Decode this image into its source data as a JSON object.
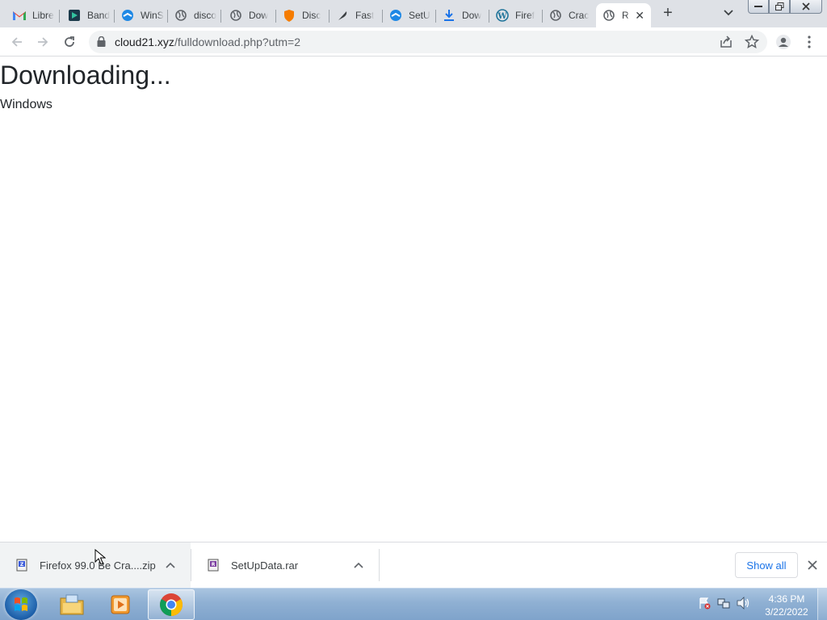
{
  "browser": {
    "tabs": [
      {
        "title": "Libre",
        "icon": "gmail-icon"
      },
      {
        "title": "Band",
        "icon": "bandicam-icon"
      },
      {
        "title": "WinS",
        "icon": "winscp-icon"
      },
      {
        "title": "disco",
        "icon": "globe-icon"
      },
      {
        "title": "Dow",
        "icon": "globe-icon"
      },
      {
        "title": "Disc",
        "icon": "shield-icon"
      },
      {
        "title": "Fast",
        "icon": "feather-icon"
      },
      {
        "title": "SetU",
        "icon": "winscp-icon"
      },
      {
        "title": "Dow",
        "icon": "download-icon"
      },
      {
        "title": "Firef",
        "icon": "wordpress-icon"
      },
      {
        "title": "Crac",
        "icon": "globe-icon"
      },
      {
        "title": "R",
        "icon": "globe-icon",
        "active": true
      }
    ],
    "url": {
      "host": "cloud21.xyz",
      "path": "/fulldownload.php?utm=2"
    }
  },
  "page": {
    "heading": "Downloading...",
    "subtext": "Windows"
  },
  "downloads": {
    "items": [
      {
        "name": "Firefox 99.0 Be Cra....zip",
        "icon": "zip-archive-icon"
      },
      {
        "name": "SetUpData.rar",
        "icon": "rar-archive-icon"
      }
    ],
    "show_all_label": "Show all"
  },
  "taskbar": {
    "time": "4:36 PM",
    "date": "3/22/2022"
  },
  "colors": {
    "tabstrip": "#dee1e6",
    "accent_link": "#1a73e8",
    "taskbar": "#8fb0d3"
  }
}
